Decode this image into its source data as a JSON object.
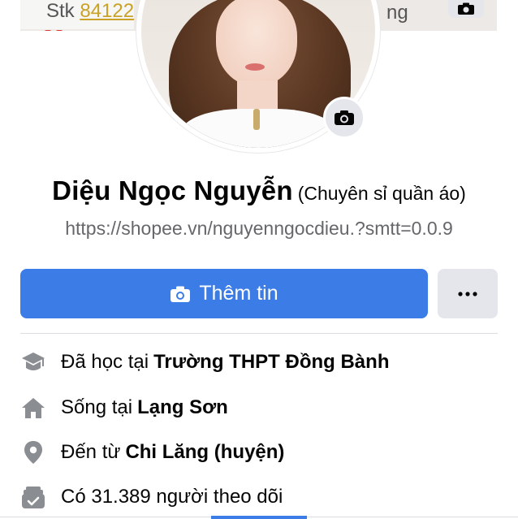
{
  "cover": {
    "left_text_prefix": "Stk ",
    "left_text_number": "84122",
    "right_text": "ng"
  },
  "profile": {
    "name": "Diệu Ngọc Nguyễn",
    "name_extra": "(Chuyên sỉ quần áo)",
    "link": "https://shopee.vn/nguyenngocdieu.?smtt=0.0.9"
  },
  "actions": {
    "add_story_label": "Thêm tin",
    "more_label": "•••"
  },
  "details": [
    {
      "icon": "graduation-cap-icon",
      "prefix": "Đã học tại",
      "value": "Trường THPT Đồng Bành"
    },
    {
      "icon": "home-icon",
      "prefix": "Sống tại",
      "value": "Lạng Sơn"
    },
    {
      "icon": "location-pin-icon",
      "prefix": "Đến từ",
      "value": "Chi Lăng (huyện)"
    },
    {
      "icon": "followers-icon",
      "prefix": "Có 31.389 người theo dõi",
      "value": ""
    }
  ],
  "colors": {
    "primary": "#3b7ce6",
    "secondary_button": "#e4e6eb",
    "muted_text": "#65676b",
    "icon_gray": "#8a8d91"
  }
}
